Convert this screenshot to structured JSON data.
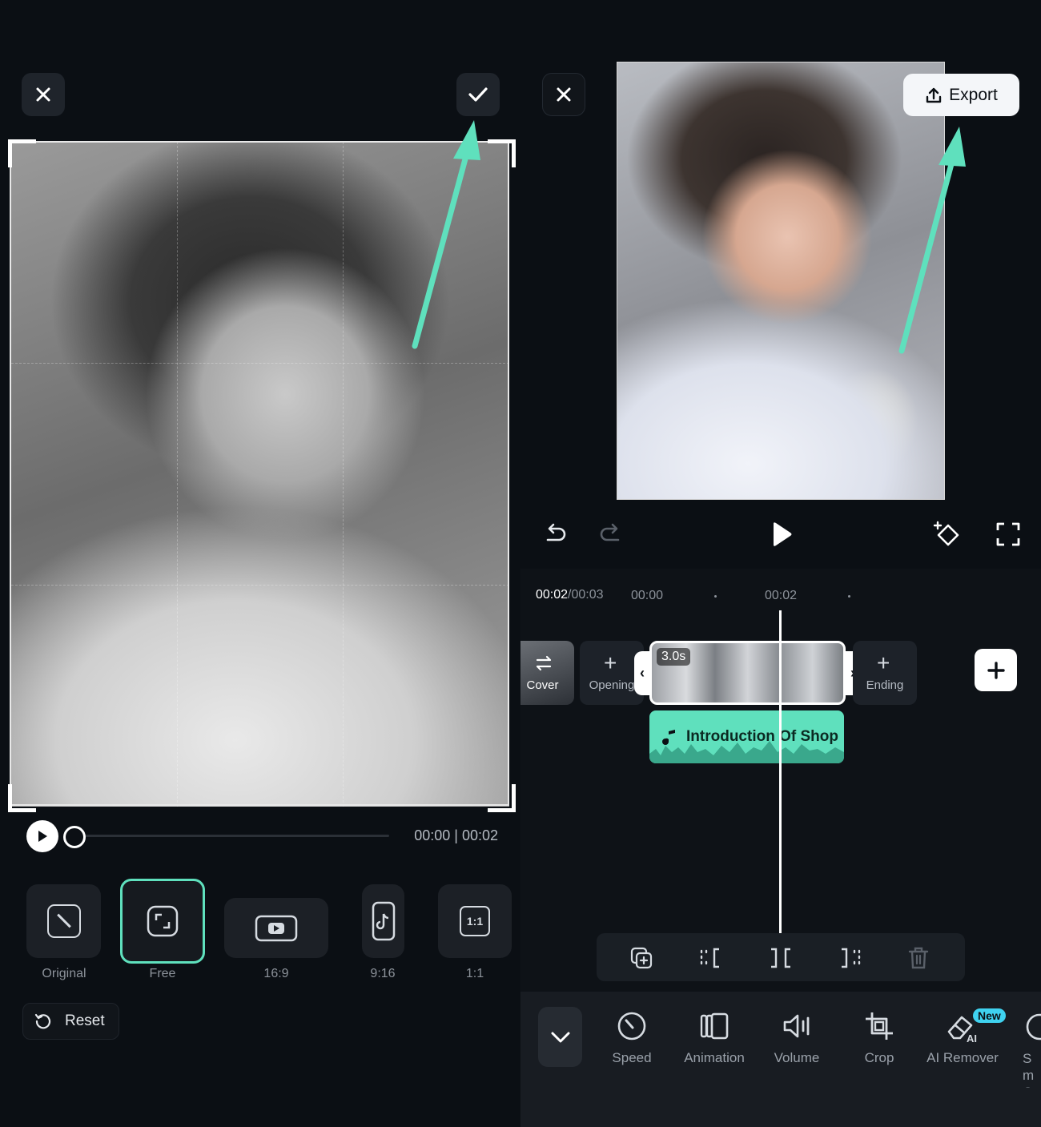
{
  "left": {
    "close_icon": "close-icon",
    "confirm_icon": "check-icon",
    "photo_desc": "black-and-white portrait",
    "player": {
      "time": "00:00 | 00:02",
      "progress": 0
    },
    "ratios": [
      {
        "label": "Original",
        "icon": "diagonal-icon"
      },
      {
        "label": "Free",
        "icon": "free-crop-icon",
        "selected": true
      },
      {
        "label": "16:9",
        "icon": "youtube-icon"
      },
      {
        "label": "9:16",
        "icon": "tiktok-icon"
      },
      {
        "label": "1:1",
        "icon": "square-ratio-icon"
      }
    ],
    "reset_label": "Reset",
    "accent": "#5fe0bd"
  },
  "right": {
    "export_label": "Export",
    "timeline": {
      "current": "00:02",
      "total": "/00:03",
      "tick1": "00:00",
      "tick2": "00:02"
    },
    "clips": {
      "cover": "Cover",
      "opening": "Opening",
      "duration": "3.0s",
      "ending": "Ending",
      "audio_title": "Introduction Of Shop"
    },
    "tools": [
      {
        "label": "Speed",
        "icon": "speed-icon"
      },
      {
        "label": "Animation",
        "icon": "animation-icon"
      },
      {
        "label": "Volume",
        "icon": "volume-icon"
      },
      {
        "label": "Crop",
        "icon": "crop-icon"
      },
      {
        "label": "AI Remover",
        "icon": "eraser-icon",
        "badge": "New"
      },
      {
        "label": "Sm Cu",
        "icon": "smart-cutout-icon"
      }
    ],
    "accent": "#5fe0bd",
    "badge_color": "#3fd2f0"
  }
}
